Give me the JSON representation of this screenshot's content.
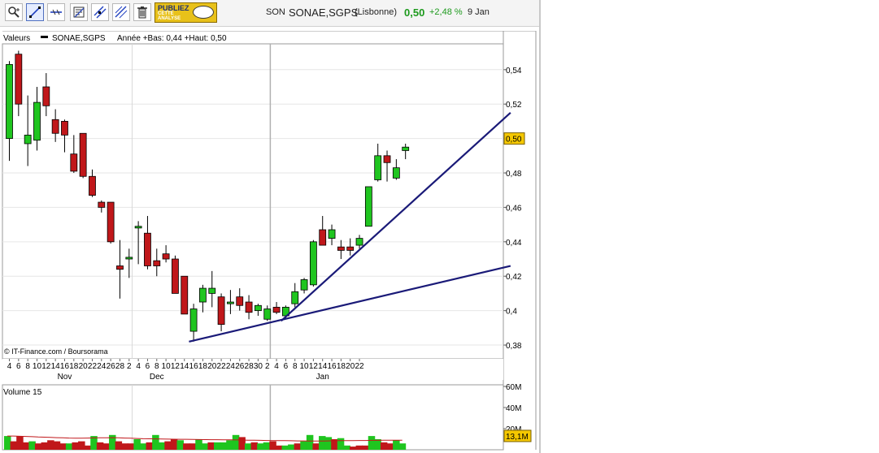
{
  "toolbar": {
    "tools": [
      {
        "name": "zoom-tool",
        "icon": "magnifier-icon"
      },
      {
        "name": "trendline-tool",
        "icon": "trendline-icon"
      },
      {
        "name": "horizontal-line-tool",
        "icon": "horizontal-line-icon"
      },
      {
        "name": "annotation-tool",
        "icon": "chart-notes-icon"
      },
      {
        "name": "channel-tool",
        "icon": "channel-icon"
      },
      {
        "name": "parallel-lines-tool",
        "icon": "parallel-lines-icon"
      },
      {
        "name": "delete-tool",
        "icon": "trash-icon"
      }
    ],
    "promo": {
      "line1": "PUBLIEZ",
      "line2": "CETTE",
      "line3": "ANALYSE",
      "icon": "speech-bubble-icon"
    }
  },
  "quote": {
    "code": "SON",
    "name": "SONAE,SGPS",
    "market": "(Lisbonne)",
    "last": "0,50",
    "change": "+2,48 %",
    "date": "9 Jan"
  },
  "colors": {
    "up": "#1fc51f",
    "down": "#c0171a",
    "trend": "#1a1a78",
    "label_bg": "#f5c800",
    "volume_ma": "#c0171a"
  },
  "chart_data": [
    {
      "type": "candlestick",
      "legend_label": "Valeurs",
      "series_name": "SONAE,SGPS",
      "info": "Année +Bas: 0,44 +Haut: 0,50",
      "last_value_label": "0,50",
      "watermark": "© IT-Finance.com / Boursorama",
      "ylim": [
        0.372,
        0.555
      ],
      "y_ticks": [
        0.54,
        0.52,
        0.5,
        0.48,
        0.46,
        0.44,
        0.42,
        0.4,
        0.38
      ],
      "y_tick_labels": [
        "0,54",
        "0,52",
        "0,5",
        "0,48",
        "0,46",
        "0,44",
        "0,42",
        "0,4",
        "0,38"
      ],
      "x_tick_labels": [
        "4",
        "6",
        "8",
        "10",
        "12",
        "14",
        "16",
        "18",
        "20",
        "22",
        "24",
        "26",
        "28",
        "2",
        "4",
        "6",
        "8",
        "10",
        "12",
        "14",
        "16",
        "18",
        "20",
        "22",
        "24",
        "26",
        "28",
        "30",
        "2",
        "4",
        "6",
        "8",
        "10",
        "12",
        "14",
        "16",
        "18",
        "20",
        "22"
      ],
      "month_labels": [
        {
          "label": "Nov",
          "tick": 6
        },
        {
          "label": "Dec",
          "tick": 16
        },
        {
          "label": "Jan",
          "tick": 34
        }
      ],
      "month_separators": [
        13,
        28
      ],
      "candles": [
        {
          "x": 0,
          "o": 0.5,
          "h": 0.545,
          "l": 0.487,
          "c": 0.543
        },
        {
          "x": 1,
          "o": 0.549,
          "h": 0.551,
          "l": 0.513,
          "c": 0.52
        },
        {
          "x": 2,
          "o": 0.497,
          "h": 0.525,
          "l": 0.484,
          "c": 0.502
        },
        {
          "x": 3,
          "o": 0.499,
          "h": 0.53,
          "l": 0.493,
          "c": 0.521
        },
        {
          "x": 4,
          "o": 0.53,
          "h": 0.538,
          "l": 0.513,
          "c": 0.519
        },
        {
          "x": 5,
          "o": 0.511,
          "h": 0.517,
          "l": 0.498,
          "c": 0.503
        },
        {
          "x": 6,
          "o": 0.51,
          "h": 0.511,
          "l": 0.492,
          "c": 0.502
        },
        {
          "x": 7,
          "o": 0.491,
          "h": 0.502,
          "l": 0.48,
          "c": 0.481
        },
        {
          "x": 8,
          "o": 0.503,
          "h": 0.503,
          "l": 0.477,
          "c": 0.478
        },
        {
          "x": 9,
          "o": 0.478,
          "h": 0.482,
          "l": 0.466,
          "c": 0.467
        },
        {
          "x": 10,
          "o": 0.463,
          "h": 0.464,
          "l": 0.457,
          "c": 0.46
        },
        {
          "x": 11,
          "o": 0.463,
          "h": 0.463,
          "l": 0.439,
          "c": 0.44
        },
        {
          "x": 12,
          "o": 0.426,
          "h": 0.441,
          "l": 0.407,
          "c": 0.424
        },
        {
          "x": 13,
          "o": 0.43,
          "h": 0.436,
          "l": 0.419,
          "c": 0.431
        },
        {
          "x": 14,
          "o": 0.448,
          "h": 0.452,
          "l": 0.427,
          "c": 0.449
        },
        {
          "x": 15,
          "o": 0.445,
          "h": 0.455,
          "l": 0.424,
          "c": 0.426
        },
        {
          "x": 16,
          "o": 0.429,
          "h": 0.436,
          "l": 0.42,
          "c": 0.426
        },
        {
          "x": 17,
          "o": 0.433,
          "h": 0.438,
          "l": 0.428,
          "c": 0.43
        },
        {
          "x": 18,
          "o": 0.43,
          "h": 0.432,
          "l": 0.41,
          "c": 0.41
        },
        {
          "x": 19,
          "o": 0.42,
          "h": 0.42,
          "l": 0.398,
          "c": 0.398
        },
        {
          "x": 20,
          "o": 0.388,
          "h": 0.404,
          "l": 0.382,
          "c": 0.401
        },
        {
          "x": 21,
          "o": 0.405,
          "h": 0.415,
          "l": 0.399,
          "c": 0.413
        },
        {
          "x": 22,
          "o": 0.41,
          "h": 0.423,
          "l": 0.402,
          "c": 0.413
        },
        {
          "x": 23,
          "o": 0.408,
          "h": 0.41,
          "l": 0.388,
          "c": 0.392
        },
        {
          "x": 24,
          "o": 0.404,
          "h": 0.412,
          "l": 0.398,
          "c": 0.405
        },
        {
          "x": 25,
          "o": 0.408,
          "h": 0.413,
          "l": 0.4,
          "c": 0.403
        },
        {
          "x": 26,
          "o": 0.405,
          "h": 0.409,
          "l": 0.395,
          "c": 0.399
        },
        {
          "x": 27,
          "o": 0.4,
          "h": 0.404,
          "l": 0.397,
          "c": 0.403
        },
        {
          "x": 28,
          "o": 0.395,
          "h": 0.403,
          "l": 0.394,
          "c": 0.401
        },
        {
          "x": 29,
          "o": 0.402,
          "h": 0.405,
          "l": 0.398,
          "c": 0.399
        },
        {
          "x": 30,
          "o": 0.397,
          "h": 0.403,
          "l": 0.395,
          "c": 0.402
        },
        {
          "x": 31,
          "o": 0.404,
          "h": 0.416,
          "l": 0.402,
          "c": 0.411
        },
        {
          "x": 32,
          "o": 0.412,
          "h": 0.419,
          "l": 0.41,
          "c": 0.418
        },
        {
          "x": 33,
          "o": 0.415,
          "h": 0.441,
          "l": 0.414,
          "c": 0.44
        },
        {
          "x": 34,
          "o": 0.447,
          "h": 0.455,
          "l": 0.438,
          "c": 0.438
        },
        {
          "x": 35,
          "o": 0.442,
          "h": 0.45,
          "l": 0.438,
          "c": 0.447
        },
        {
          "x": 36,
          "o": 0.437,
          "h": 0.441,
          "l": 0.43,
          "c": 0.435
        },
        {
          "x": 37,
          "o": 0.437,
          "h": 0.442,
          "l": 0.432,
          "c": 0.435
        },
        {
          "x": 38,
          "o": 0.438,
          "h": 0.444,
          "l": 0.436,
          "c": 0.442
        },
        {
          "x": 39,
          "o": 0.449,
          "h": 0.472,
          "l": 0.449,
          "c": 0.472
        },
        {
          "x": 40,
          "o": 0.476,
          "h": 0.497,
          "l": 0.475,
          "c": 0.49
        },
        {
          "x": 41,
          "o": 0.49,
          "h": 0.493,
          "l": 0.475,
          "c": 0.486
        },
        {
          "x": 42,
          "o": 0.477,
          "h": 0.488,
          "l": 0.476,
          "c": 0.483
        },
        {
          "x": 43,
          "o": 0.493,
          "h": 0.497,
          "l": 0.488,
          "c": 0.495
        }
      ],
      "trend_lines": [
        {
          "x1": 19.5,
          "y1": 0.382,
          "x2": 54.4,
          "y2": 0.426
        },
        {
          "x1": 29.5,
          "y1": 0.394,
          "x2": 54.4,
          "y2": 0.515
        }
      ]
    },
    {
      "type": "bar",
      "legend_label": "Volume 15",
      "last_value_label": "13,1M",
      "ylim": [
        0,
        60
      ],
      "y_ticks": [
        60,
        40,
        20
      ],
      "y_tick_labels": [
        "60M",
        "40M",
        "20M"
      ],
      "values": [
        13,
        8,
        13,
        7,
        8,
        6,
        7,
        9,
        8,
        6,
        6,
        7,
        8,
        4,
        13,
        7,
        6,
        14,
        8,
        6,
        6,
        10,
        6,
        7,
        14,
        7,
        8,
        10,
        9,
        6,
        6,
        10,
        6,
        7,
        7,
        7,
        9,
        14,
        12,
        6,
        7,
        6,
        7,
        8,
        4,
        4,
        5,
        6,
        8,
        14,
        6,
        13,
        12,
        10,
        11,
        4,
        3,
        4,
        4,
        13,
        10,
        7,
        6,
        9,
        6
      ],
      "directions": [
        "u",
        "d",
        "d",
        "d",
        "u",
        "d",
        "d",
        "d",
        "d",
        "d",
        "u",
        "d",
        "d",
        "d",
        "u",
        "d",
        "d",
        "u",
        "d",
        "d",
        "d",
        "u",
        "u",
        "d",
        "u",
        "u",
        "d",
        "d",
        "u",
        "d",
        "d",
        "u",
        "u",
        "d",
        "u",
        "u",
        "u",
        "u",
        "d",
        "u",
        "d",
        "u",
        "u",
        "d",
        "d",
        "u",
        "u",
        "d",
        "u",
        "u",
        "d",
        "u",
        "u",
        "d",
        "u",
        "u",
        "d",
        "d",
        "d",
        "u",
        "u",
        "d",
        "d",
        "u",
        "u"
      ],
      "moving_average": [
        13,
        13,
        12.8,
        12.6,
        12.4,
        12.1,
        11.9,
        11.7,
        11.5,
        11.3,
        11.1,
        11,
        11,
        11.1,
        11.2,
        11.3,
        11.4,
        11.5,
        11.3,
        11.1,
        10.9,
        10.7,
        10.5,
        10.4,
        10.3,
        10.2,
        10.1,
        10,
        9.9,
        9.9,
        9.8,
        9.7,
        9.6,
        9.5,
        9.5,
        9.4,
        9.4,
        9.3,
        9.2,
        9.1,
        9,
        8.9,
        8.8,
        8.7,
        8.6,
        8.6,
        8.5,
        8.4,
        8.4,
        8.3,
        8.3,
        8.3,
        8.4,
        8.5,
        8.6,
        8.6,
        8.7,
        8.8,
        8.8,
        8.9,
        8.9,
        9,
        9,
        9,
        9
      ]
    }
  ]
}
